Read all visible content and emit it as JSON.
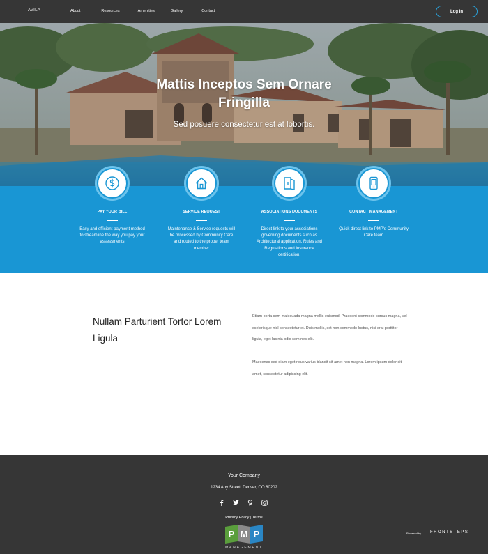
{
  "nav": {
    "brand": "AVILA",
    "links": [
      "About",
      "Resources",
      "Amenities",
      "Gallery",
      "Contact"
    ],
    "login_label": "Log In"
  },
  "hero": {
    "title": "Mattis Inceptos Sem Ornare Fringilla",
    "subtitle": "Sed posuere consectetur est at lobortis."
  },
  "features": [
    {
      "icon": "dollar-icon",
      "title": "PAY YOUR BILL",
      "desc": "Easy and efficient payment method to streamline the way you pay your assessments"
    },
    {
      "icon": "house-icon",
      "title": "SERVICE REQUEST",
      "desc": "Maintenance & Service requests will be processed by Community Care and routed to the proper team member"
    },
    {
      "icon": "document-icon",
      "title": "ASSOCIATIONS DOCUMENTS",
      "desc": "Direct link to your associations governing documents such as Architectural application, Rules and Regulations and Insurance certification."
    },
    {
      "icon": "mobile-icon",
      "title": "CONTACT MANAGEMENT",
      "desc": "Quick direct link to PMP's Community Care team"
    }
  ],
  "content": {
    "title": "Nullam Parturient Tortor Lorem Ligula",
    "para1": "Etiam porta sem malesuada magna mollis euismod. Praesent commodo cursus magna, vel scelerisque nisl consectetur et. Duis mollis, est non commodo luctus, nisi erat porttitor ligula, eget lacinia odio sem nec elit.",
    "para2": "Maecenas sed diam eget risus varius blandit sit amet non magna. Lorem ipsum dolor sit amet, consectetur adipiscing elit."
  },
  "footer": {
    "company": "Your Company",
    "address": "1234 Any Street, Denver, CO 80202",
    "social": [
      "facebook-icon",
      "twitter-icon",
      "pinterest-icon",
      "instagram-icon"
    ],
    "privacy": "Privacy Policy",
    "separator": "|",
    "terms": "Terms",
    "logo_letters": [
      "P",
      "M",
      "P"
    ],
    "logo_word": "MANAGEMENT",
    "powered_by": "Powered by",
    "frontsteps": "FRONTSTEPS"
  },
  "colors": {
    "nav_bg": "#363636",
    "accent_blue": "#1996d4",
    "footer_bg": "#363636",
    "logo_green": "#5a9e3c",
    "logo_gray": "#8a8a8a",
    "logo_blue": "#2a86c4"
  }
}
